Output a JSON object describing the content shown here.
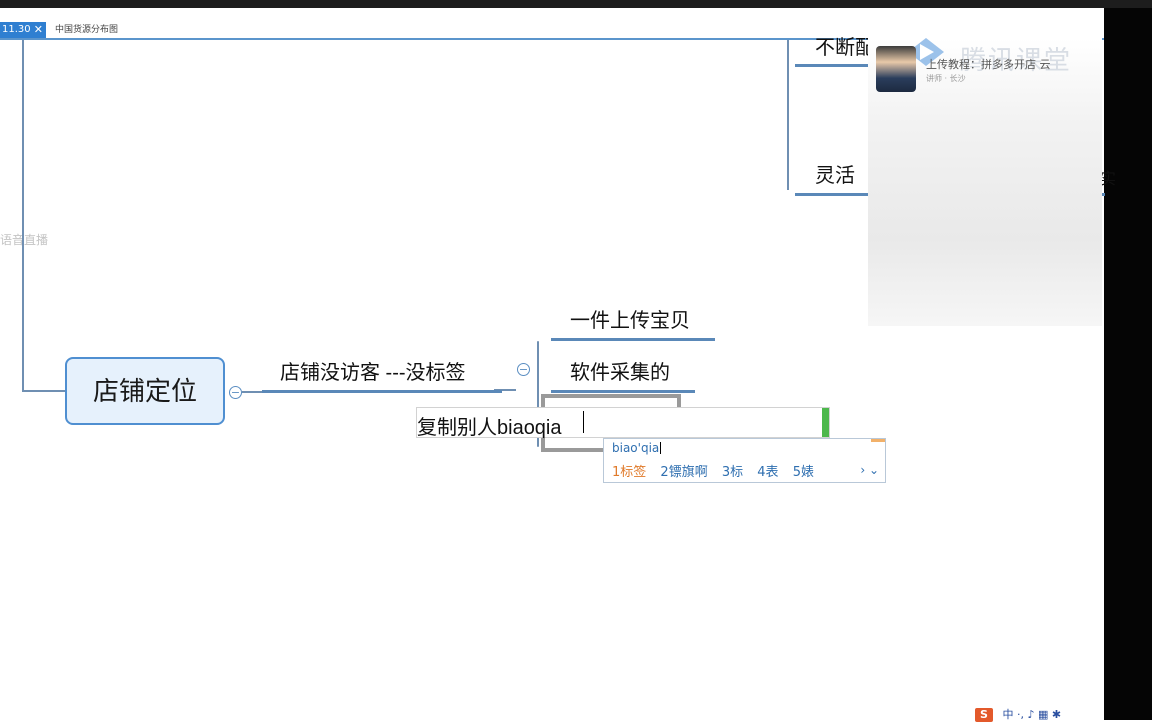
{
  "tabs": {
    "active_label": "11.30",
    "close_glyph": "✕",
    "second_label": "中国货源分布图"
  },
  "mindmap": {
    "central_topic": "店铺定位",
    "branch_topic": "店铺没访客  ---没标签",
    "children": [
      "一件上传宝贝",
      "软件采集的"
    ],
    "editing_text": "复制别人biaoqia",
    "top_right_topics": [
      "不断配",
      "灵活"
    ],
    "partial_right": "实",
    "collapse_glyph": "−"
  },
  "ime": {
    "pinyin": "biao'qia",
    "candidates": [
      "1标签",
      "2镖旗啊",
      "3标",
      "4表",
      "5婊"
    ],
    "nav": "› ⌄"
  },
  "video": {
    "brand": "腾讯课堂",
    "title": "上传教程：拼多多开店 云",
    "subtitle": "讲师 · 长沙"
  },
  "left_watermark": "语音直播",
  "tray": {
    "ime_logo": "S",
    "items": "中 ·, ♪ ▦ ✱"
  },
  "colors": {
    "accent": "#4f8fd1",
    "node_fill": "#e6f1fc",
    "tab_active": "#2f7fd1",
    "ime_first": "#e07a2a"
  }
}
